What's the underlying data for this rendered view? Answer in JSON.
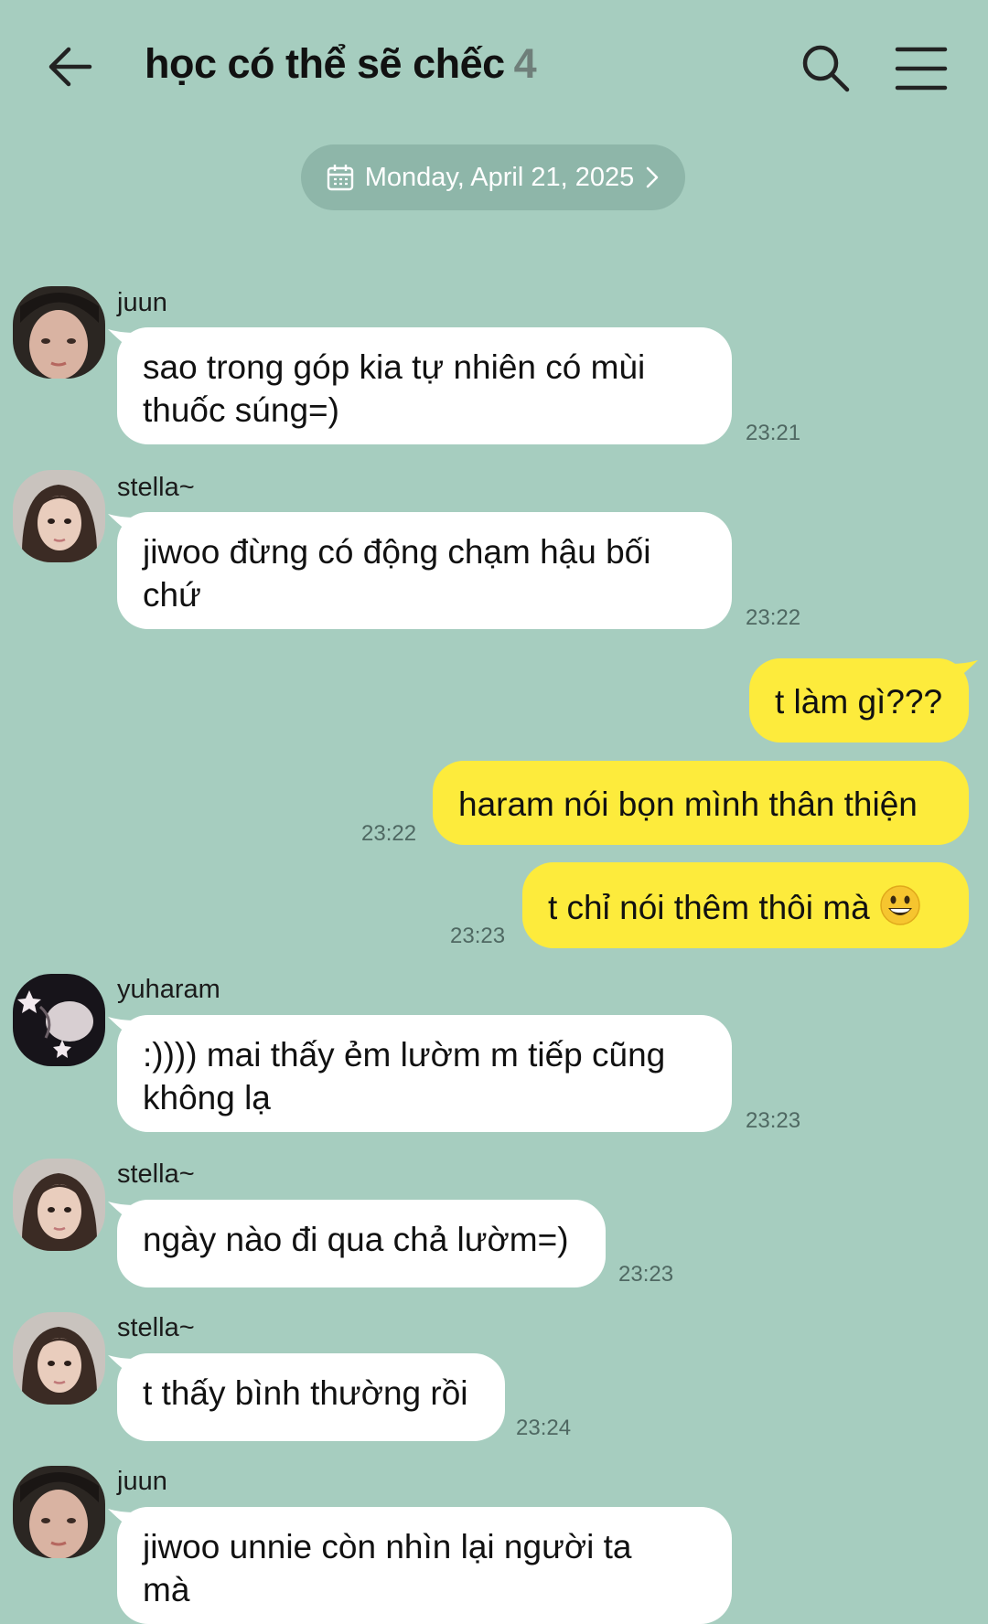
{
  "header": {
    "back_icon": "arrow-left-icon",
    "title": "học có thể sẽ chếc",
    "member_count": "4",
    "search_icon": "search-icon",
    "menu_icon": "hamburger-menu-icon"
  },
  "date_divider": {
    "icon": "calendar-icon",
    "label": "Monday, April 21, 2025",
    "chevron_icon": "chevron-right-icon"
  },
  "messages": [
    {
      "sender": "juun",
      "line1": "sao trong góp kia tự nhiên có mùi",
      "line2": "thuốc súng=)",
      "time": "23:21"
    },
    {
      "sender": "stella~",
      "line1": "jiwoo đừng có động chạm hậu bối",
      "line2": "chứ",
      "time": "23:22"
    },
    {
      "sender": "me",
      "text": "t làm gì???",
      "time": ""
    },
    {
      "sender": "me",
      "text": "haram nói bọn mình thân thiện",
      "time": "23:22"
    },
    {
      "sender": "me",
      "text": "t chỉ nói thêm thôi mà",
      "emoji": "grinning-face-emoji",
      "time": "23:23"
    },
    {
      "sender": "yuharam",
      "line1": ":)))) mai thấy ẻm lườm m tiếp cũng",
      "line2": "không lạ",
      "time": "23:23"
    },
    {
      "sender": "stella~",
      "text": "ngày nào đi qua chả lườm=)",
      "time": "23:23"
    },
    {
      "sender": "stella~",
      "text": "t thấy bình thường rồi",
      "time": "23:24"
    },
    {
      "sender": "juun",
      "line1": "jiwoo unnie còn nhìn lại người ta",
      "line2": "mà",
      "time": ""
    }
  ],
  "colors": {
    "background": "#a6cdbf",
    "incoming_bubble": "#ffffff",
    "outgoing_bubble": "#fdeb3c",
    "date_pill": "#8eb6a9"
  }
}
